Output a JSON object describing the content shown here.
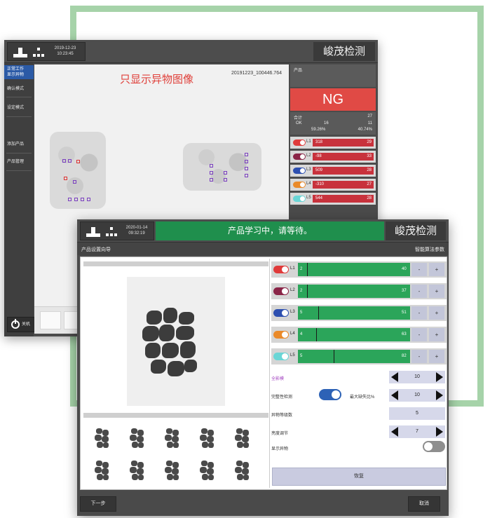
{
  "brand_title": "峻茂检测",
  "back_window": {
    "date": "2019-12-23",
    "time": "10:23:45",
    "sidebar": {
      "items": [
        "正常工作",
        "显示异物",
        "确认模式",
        "设定模式",
        "添加产品",
        "产品管理"
      ],
      "power_label": "关机"
    },
    "image": {
      "title": "只显示异物图像",
      "code": "20191223_100446.764"
    },
    "panel": {
      "product_label": "产品",
      "result": "NG",
      "total_label": "合计",
      "total_value": "27",
      "ok_label": "OK",
      "ok_count": "16",
      "ng_count": "11",
      "ok_pct": "59.26%",
      "ng_pct": "40.74%",
      "lanes": [
        {
          "name": "L1",
          "left": "318",
          "right": "29",
          "color": "#e03a3a"
        },
        {
          "name": "L2",
          "left": "-98",
          "right": "33",
          "color": "#8a2447"
        },
        {
          "name": "L3",
          "left": "509",
          "right": "28",
          "color": "#2d4fb0"
        },
        {
          "name": "L4",
          "left": "-310",
          "right": "27",
          "color": "#ea8a2a"
        },
        {
          "name": "L5",
          "left": "544",
          "right": "28",
          "color": "#6ad6d6"
        }
      ]
    }
  },
  "front_window": {
    "date": "2020-01-14",
    "time": "09:32:19",
    "status_banner": "产品学习中，请等待。",
    "subheader_left": "产品设置向导",
    "subheader_right": "智能算法参数",
    "lanes": [
      {
        "name": "L1",
        "left": "2",
        "right": "40",
        "color": "#e03a3a",
        "marker": 0.08
      },
      {
        "name": "L2",
        "left": "2",
        "right": "37",
        "color": "#8a2447",
        "marker": 0.08
      },
      {
        "name": "L3",
        "left": "5",
        "right": "51",
        "color": "#2d4fb0",
        "marker": 0.18
      },
      {
        "name": "L4",
        "left": "4",
        "right": "63",
        "color": "#ea8a2a",
        "marker": 0.16
      },
      {
        "name": "L5",
        "left": "5",
        "right": "82",
        "color": "#6ad6d6",
        "marker": 0.32
      }
    ],
    "minus": "-",
    "plus": "+",
    "options": {
      "all_shadow_label": "全影模",
      "all_shadow_value": "10",
      "integrity_label": "完整性检测",
      "max_defect_label": "最大缺失比%",
      "max_defect_value": "10",
      "foreign_level_label": "异物等级数",
      "foreign_level_value": "5",
      "brightness_label": "亮度调节",
      "brightness_value": "7",
      "show_foreign_label": "显示异物"
    },
    "reset_label": "恢复",
    "next_label": "下一步",
    "cancel_label": "取消"
  }
}
